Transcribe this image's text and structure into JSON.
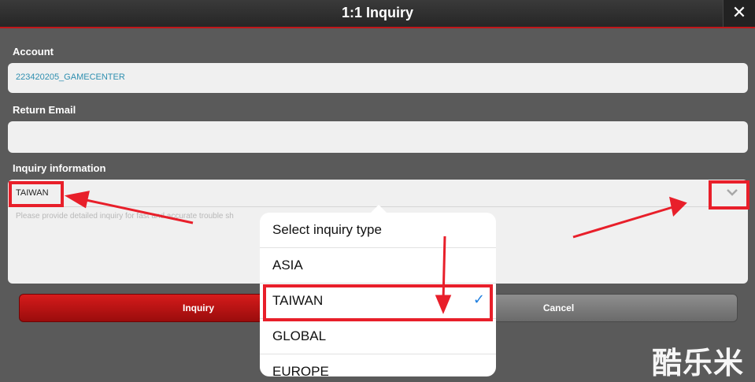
{
  "header": {
    "title": "1:1 Inquiry",
    "close_icon": "close-icon"
  },
  "account": {
    "label": "Account",
    "value": "223420205_GAMECENTER"
  },
  "return_email": {
    "label": "Return Email",
    "value": ""
  },
  "inquiry_info": {
    "label": "Inquiry information",
    "selected_type": "TAIWAN",
    "placeholder": "Please provide detailed inquiry for fast and accurate trouble sh",
    "dropdown_icon": "chevron-down-icon"
  },
  "buttons": {
    "inquiry": "Inquiry",
    "cancel": "Cancel"
  },
  "popover": {
    "title": "Select inquiry type",
    "options": [
      {
        "label": "ASIA",
        "selected": false
      },
      {
        "label": "TAIWAN",
        "selected": true
      },
      {
        "label": "GLOBAL",
        "selected": false
      },
      {
        "label": "EUROPE",
        "selected": false
      }
    ],
    "check_mark": "✓"
  },
  "watermark": "酷乐米",
  "colors": {
    "accent": "#c0161a",
    "highlight": "#e81f2a",
    "check": "#1f7fe0",
    "account_text": "#2f8fb0"
  }
}
